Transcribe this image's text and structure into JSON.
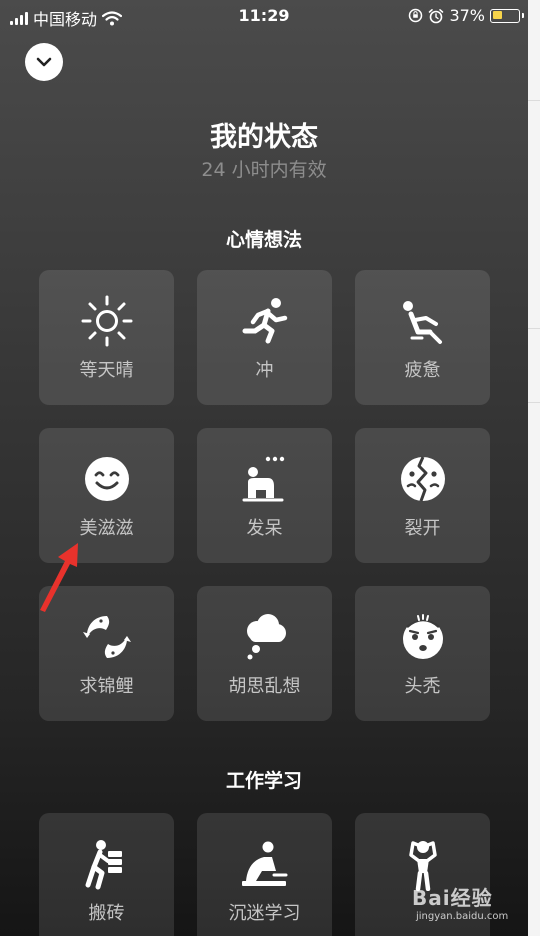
{
  "status_bar": {
    "carrier": "中国移动",
    "time": "11:29",
    "battery_percent": "37%",
    "battery_level": 0.37,
    "battery_color": "#f7d44a"
  },
  "header": {
    "title": "我的状态",
    "subtitle": "24 小时内有效"
  },
  "sections": [
    {
      "title": "心情想法",
      "tiles": [
        {
          "label": "等天晴",
          "icon": "sun-icon"
        },
        {
          "label": "冲",
          "icon": "running-icon"
        },
        {
          "label": "疲惫",
          "icon": "tired-reclining-icon"
        },
        {
          "label": "美滋滋",
          "icon": "smile-face-icon"
        },
        {
          "label": "发呆",
          "icon": "daydream-icon"
        },
        {
          "label": "裂开",
          "icon": "cracked-face-icon"
        },
        {
          "label": "求锦鲤",
          "icon": "koi-fish-icon"
        },
        {
          "label": "胡思乱想",
          "icon": "thought-cloud-icon"
        },
        {
          "label": "头秃",
          "icon": "bald-head-icon"
        }
      ]
    },
    {
      "title": "工作学习",
      "tiles": [
        {
          "label": "搬砖",
          "icon": "carrying-bricks-icon"
        },
        {
          "label": "沉迷学习",
          "icon": "studying-icon"
        },
        {
          "label": "",
          "icon": "stressed-person-icon"
        }
      ]
    }
  ],
  "watermark": {
    "main": "Bai经验",
    "sub": "jingyan.baidu.com"
  },
  "annotation": {
    "arrow_color": "#e8322c"
  }
}
